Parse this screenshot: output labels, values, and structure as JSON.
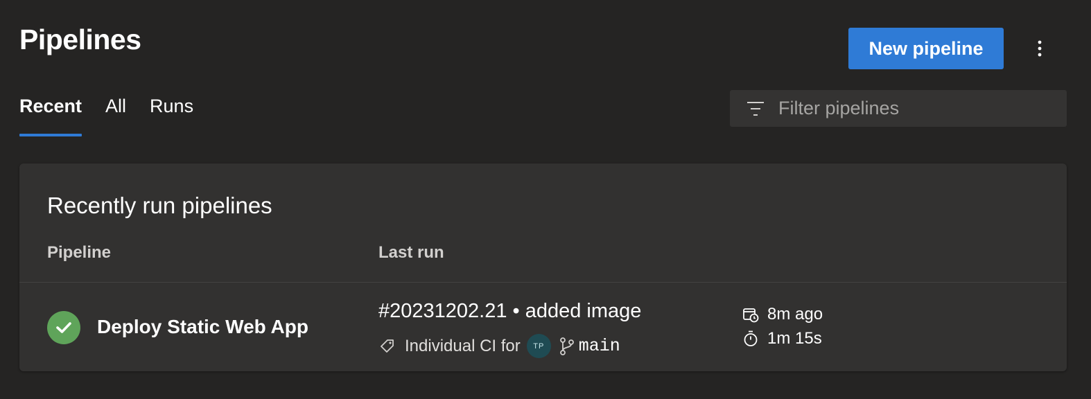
{
  "header": {
    "title": "Pipelines",
    "new_button_label": "New pipeline",
    "more_icon": "more-vertical-icon"
  },
  "tabs": [
    {
      "label": "Recent",
      "active": true
    },
    {
      "label": "All",
      "active": false
    },
    {
      "label": "Runs",
      "active": false
    }
  ],
  "filter": {
    "placeholder": "Filter pipelines",
    "value": "",
    "icon": "filter-icon"
  },
  "card": {
    "title": "Recently run pipelines",
    "columns": [
      "Pipeline",
      "Last run"
    ],
    "rows": [
      {
        "status": "succeeded",
        "status_icon": "check-circle-icon",
        "pipeline": "Deploy Static Web App",
        "run_title": "#20231202.21 • added image",
        "trigger": "Individual CI for",
        "avatar_initials": "TP",
        "branch": "main",
        "ago": "8m ago",
        "duration": "1m 15s"
      }
    ]
  },
  "colors": {
    "background": "#252423",
    "card": "#323130",
    "accent": "#2f7bd6",
    "success": "#5fa45a",
    "avatar": "#1f4b53"
  }
}
